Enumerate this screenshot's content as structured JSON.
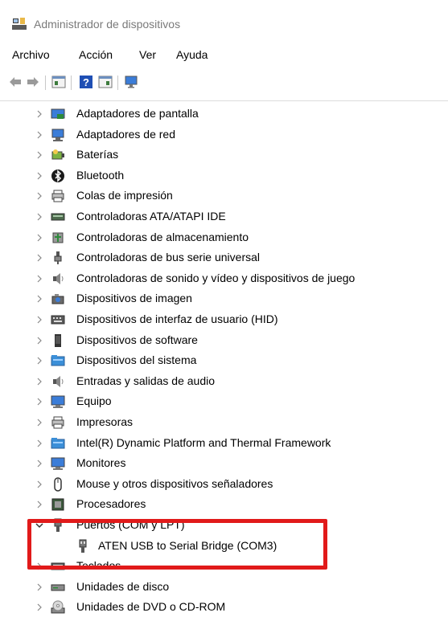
{
  "window": {
    "title": "Administrador de dispositivos",
    "icon": "device-manager-icon"
  },
  "menu": [
    "Archivo",
    "Acción",
    "Ver",
    "Ayuda"
  ],
  "toolbar": {
    "buttons": [
      "back-arrow-icon",
      "forward-arrow-icon",
      "properties-icon",
      "help-icon",
      "update-driver-icon",
      "monitor-scan-icon"
    ]
  },
  "tree": {
    "items": [
      {
        "label": "Adaptadores de pantalla",
        "icon": "display-adapter-icon",
        "expanded": false
      },
      {
        "label": "Adaptadores de red",
        "icon": "network-adapter-icon",
        "expanded": false
      },
      {
        "label": "Baterías",
        "icon": "battery-icon",
        "expanded": false
      },
      {
        "label": "Bluetooth",
        "icon": "bluetooth-icon",
        "expanded": false
      },
      {
        "label": "Colas de impresión",
        "icon": "print-queue-icon",
        "expanded": false
      },
      {
        "label": "Controladoras ATA/ATAPI IDE",
        "icon": "ide-controller-icon",
        "expanded": false
      },
      {
        "label": "Controladoras de almacenamiento",
        "icon": "storage-controller-icon",
        "expanded": false
      },
      {
        "label": "Controladoras de bus serie universal",
        "icon": "usb-icon",
        "expanded": false
      },
      {
        "label": "Controladoras de sonido y vídeo y dispositivos de juego",
        "icon": "speaker-icon",
        "expanded": false
      },
      {
        "label": "Dispositivos de imagen",
        "icon": "camera-icon",
        "expanded": false
      },
      {
        "label": "Dispositivos de interfaz de usuario (HID)",
        "icon": "hid-icon",
        "expanded": false
      },
      {
        "label": "Dispositivos de software",
        "icon": "software-device-icon",
        "expanded": false
      },
      {
        "label": "Dispositivos del sistema",
        "icon": "system-folder-icon",
        "expanded": false
      },
      {
        "label": "Entradas y salidas de audio",
        "icon": "speaker-icon",
        "expanded": false
      },
      {
        "label": "Equipo",
        "icon": "computer-icon",
        "expanded": false
      },
      {
        "label": "Impresoras",
        "icon": "printer-icon",
        "expanded": false
      },
      {
        "label": "Intel(R) Dynamic Platform and Thermal Framework",
        "icon": "system-folder-icon",
        "expanded": false
      },
      {
        "label": "Monitores",
        "icon": "monitor-icon",
        "expanded": false
      },
      {
        "label": "Mouse y otros dispositivos señaladores",
        "icon": "mouse-icon",
        "expanded": false
      },
      {
        "label": "Procesadores",
        "icon": "processor-icon",
        "expanded": false
      },
      {
        "label": "Puertos (COM y LPT)",
        "icon": "port-icon",
        "expanded": true
      },
      {
        "label": "ATEN USB to Serial Bridge (COM3)",
        "icon": "port-icon",
        "child": true
      },
      {
        "label": "Teclados",
        "icon": "keyboard-icon",
        "expanded": false
      },
      {
        "label": "Unidades de disco",
        "icon": "disk-drive-icon",
        "expanded": false
      },
      {
        "label": "Unidades de DVD o CD-ROM",
        "icon": "dvd-drive-icon",
        "expanded": false
      }
    ]
  },
  "colors": {
    "highlight_border": "#e11a1a",
    "title_text": "#7a7a7a"
  }
}
